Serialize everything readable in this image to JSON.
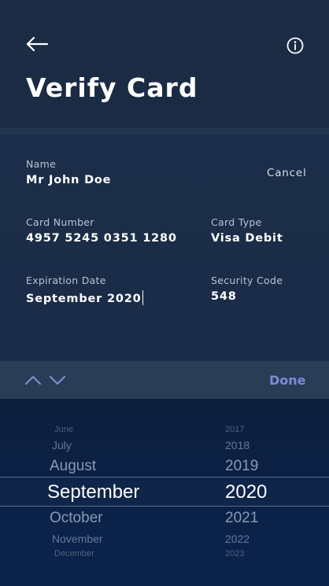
{
  "header": {
    "title": "Verify Card"
  },
  "form": {
    "name_label": "Name",
    "name_value": "Mr John Doe",
    "cancel_label": "Cancel",
    "card_number_label": "Card Number",
    "card_number_value": "4957 5245 0351 1280",
    "card_type_label": "Card Type",
    "card_type_value": "Visa Debit",
    "expiration_label": "Expiration Date",
    "expiration_value": "September 2020",
    "security_label": "Security Code",
    "security_value": "548"
  },
  "toolbar": {
    "done_label": "Done"
  },
  "picker": {
    "months": [
      "June",
      "July",
      "August",
      "September",
      "October",
      "November",
      "December"
    ],
    "years": [
      "2017",
      "2018",
      "2019",
      "2020",
      "2021",
      "2022",
      "2023"
    ],
    "selected_month": "September",
    "selected_year": "2020"
  },
  "icons": {
    "back": "back-arrow-icon",
    "info": "info-icon",
    "up": "chevron-up-icon",
    "down": "chevron-down-icon"
  },
  "colors": {
    "background": "#1b2b44",
    "picker_background": "#0b2147",
    "accent": "#7c8cd6",
    "label": "#b9c3d3"
  }
}
